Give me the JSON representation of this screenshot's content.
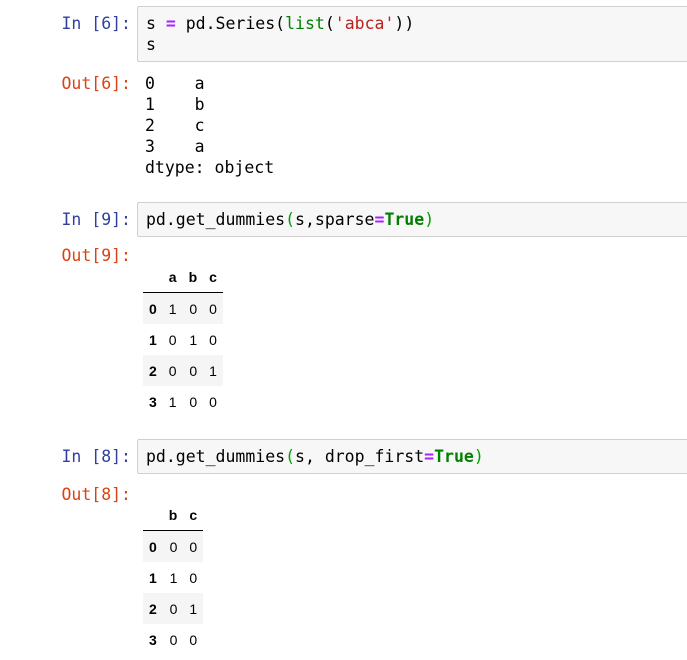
{
  "cells": [
    {
      "in_prompt": "In [6]:",
      "code": {
        "l1_a": "s ",
        "l1_op": "=",
        "l1_b": " pd.Series(",
        "l1_fn": "list",
        "l1_c": "(",
        "l1_str": "'abca'",
        "l1_d": "))",
        "l2": "s"
      },
      "out_prompt": "Out[6]:",
      "output": "0    a\n1    b\n2    c\n3    a\ndtype: object"
    },
    {
      "in_prompt": "In [9]:",
      "code": {
        "a": "pd.get_dummies",
        "p1": "(",
        "b": "s,sparse",
        "op": "=",
        "kw": "True",
        "p2": ")"
      },
      "out_prompt": "Out[9]:",
      "table": {
        "columns": [
          "a",
          "b",
          "c"
        ],
        "rows": [
          {
            "index": "0",
            "values": [
              "1",
              "0",
              "0"
            ]
          },
          {
            "index": "1",
            "values": [
              "0",
              "1",
              "0"
            ]
          },
          {
            "index": "2",
            "values": [
              "0",
              "0",
              "1"
            ]
          },
          {
            "index": "3",
            "values": [
              "1",
              "0",
              "0"
            ]
          }
        ]
      }
    },
    {
      "in_prompt": "In [8]:",
      "code": {
        "a": "pd.get_dummies",
        "p1": "(",
        "b": "s, drop_first",
        "op": "=",
        "kw": "True",
        "p2": ")"
      },
      "out_prompt": "Out[8]:",
      "table": {
        "columns": [
          "b",
          "c"
        ],
        "rows": [
          {
            "index": "0",
            "values": [
              "0",
              "0"
            ]
          },
          {
            "index": "1",
            "values": [
              "1",
              "0"
            ]
          },
          {
            "index": "2",
            "values": [
              "0",
              "1"
            ]
          },
          {
            "index": "3",
            "values": [
              "0",
              "0"
            ]
          }
        ]
      }
    }
  ]
}
